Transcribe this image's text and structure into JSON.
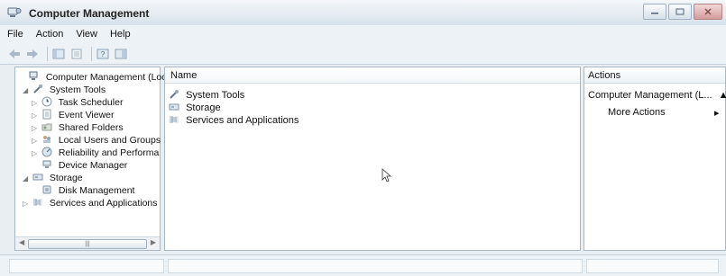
{
  "window": {
    "title": "Computer Management"
  },
  "menu": [
    {
      "label": "File"
    },
    {
      "label": "Action"
    },
    {
      "label": "View"
    },
    {
      "label": "Help"
    }
  ],
  "tree": {
    "items": [
      {
        "label": "Computer Management (Local)",
        "icon": "computer-management-icon",
        "level": 0,
        "arrow": ""
      },
      {
        "label": "System Tools",
        "icon": "system-tools-icon",
        "level": 1,
        "arrow": "◢"
      },
      {
        "label": "Task Scheduler",
        "icon": "clock-icon",
        "level": 2,
        "arrow": "▷"
      },
      {
        "label": "Event Viewer",
        "icon": "event-viewer-icon",
        "level": 2,
        "arrow": "▷"
      },
      {
        "label": "Shared Folders",
        "icon": "shared-folder-icon",
        "level": 2,
        "arrow": "▷"
      },
      {
        "label": "Local Users and Groups",
        "icon": "users-icon",
        "level": 2,
        "arrow": "▷"
      },
      {
        "label": "Reliability and Performa",
        "icon": "reliability-icon",
        "level": 2,
        "arrow": "▷"
      },
      {
        "label": "Device Manager",
        "icon": "device-manager-icon",
        "level": 2,
        "arrow": ""
      },
      {
        "label": "Storage",
        "icon": "storage-icon",
        "level": 1,
        "arrow": "◢"
      },
      {
        "label": "Disk Management",
        "icon": "disk-management-icon",
        "level": 2,
        "arrow": ""
      },
      {
        "label": "Services and Applications",
        "icon": "services-icon",
        "level": 1,
        "arrow": "▷"
      }
    ]
  },
  "center": {
    "header": "Name",
    "rows": [
      {
        "label": "System Tools",
        "icon": "system-tools-icon"
      },
      {
        "label": "Storage",
        "icon": "storage-icon"
      },
      {
        "label": "Services and Applications",
        "icon": "services-icon"
      }
    ]
  },
  "actions": {
    "title": "Actions",
    "section": "Computer Management (L...",
    "more": "More Actions"
  }
}
